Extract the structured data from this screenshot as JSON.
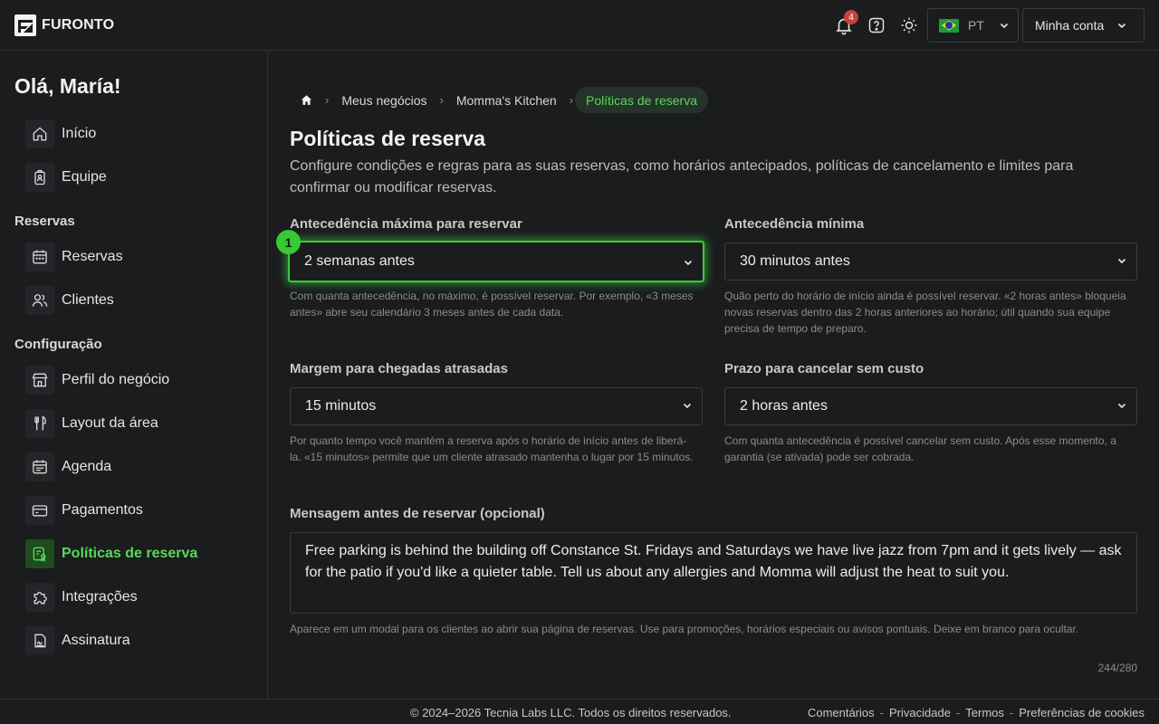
{
  "header": {
    "brand": "FURONTO",
    "notifications_count": "4",
    "language": "PT",
    "account_label": "Minha conta"
  },
  "sidebar": {
    "greeting": "Olá, María!",
    "top_items": [
      {
        "label": "Início",
        "icon": "home-icon"
      },
      {
        "label": "Equipe",
        "icon": "team-icon"
      }
    ],
    "section_reservas": "Reservas",
    "reservas_items": [
      {
        "label": "Reservas",
        "icon": "calendar-icon"
      },
      {
        "label": "Clientes",
        "icon": "users-icon"
      }
    ],
    "section_config": "Configuração",
    "config_items": [
      {
        "label": "Perfil do negócio",
        "icon": "store-icon"
      },
      {
        "label": "Layout da área",
        "icon": "fork-knife-icon"
      },
      {
        "label": "Agenda",
        "icon": "agenda-icon"
      },
      {
        "label": "Pagamentos",
        "icon": "card-icon"
      },
      {
        "label": "Políticas de reserva",
        "icon": "policy-icon",
        "active": true
      },
      {
        "label": "Integrações",
        "icon": "puzzle-icon"
      },
      {
        "label": "Assinatura",
        "icon": "signature-icon"
      }
    ]
  },
  "breadcrumb": [
    "Meus negócios",
    "Momma's Kitchen",
    "Políticas de reserva"
  ],
  "page": {
    "title": "Políticas de reserva",
    "description": "Configure condições e regras para as suas reservas, como horários antecipados, políticas de cancelamento e limites para confirmar ou modificar reservas."
  },
  "fields": {
    "max_advance": {
      "label": "Antecedência máxima para reservar",
      "value": "2 semanas antes",
      "help": "Com quanta antecedência, no máximo, é possível reservar. Por exemplo, «3 meses antes» abre seu calendário 3 meses antes de cada data."
    },
    "min_advance": {
      "label": "Antecedência mínima",
      "value": "30 minutos antes",
      "help": "Quão perto do horário de início ainda é possível reservar. «2 horas antes» bloqueia novas reservas dentro das 2 horas anteriores ao horário; útil quando sua equipe precisa de tempo de preparo."
    },
    "late_margin": {
      "label": "Margem para chegadas atrasadas",
      "value": "15 minutos",
      "help": "Por quanto tempo você mantém a reserva após o horário de início antes de liberá-la. «15 minutos» permite que um cliente atrasado mantenha o lugar por 15 minutos."
    },
    "cancel_deadline": {
      "label": "Prazo para cancelar sem custo",
      "value": "2 horas antes",
      "help": "Com quanta antecedência é possível cancelar sem custo. Após esse momento, a garantia (se ativada) pode ser cobrada."
    },
    "message": {
      "label": "Mensagem antes de reservar (opcional)",
      "value": "Free parking is behind the building off Constance St. Fridays and Saturdays we have live jazz from 7pm and it gets lively — ask for the patio if you'd like a quieter table. Tell us about any allergies and Momma will adjust the heat to suit you.",
      "help": "Aparece em um modal para os clientes ao abrir sua página de reservas. Use para promoções, horários especiais ou avisos pontuais. Deixe em branco para ocultar.",
      "counter": "244/280"
    }
  },
  "annotation_marker": "1",
  "footer": {
    "copyright": "© 2024–2026 Tecnia Labs LLC. Todos os direitos reservados.",
    "links": [
      "Comentários",
      "Privacidade",
      "Termos",
      "Preferências de cookies"
    ],
    "separator": "-"
  },
  "colors": {
    "background": "#1b1c1e",
    "accent": "#58d858",
    "badge": "#c9413a"
  }
}
